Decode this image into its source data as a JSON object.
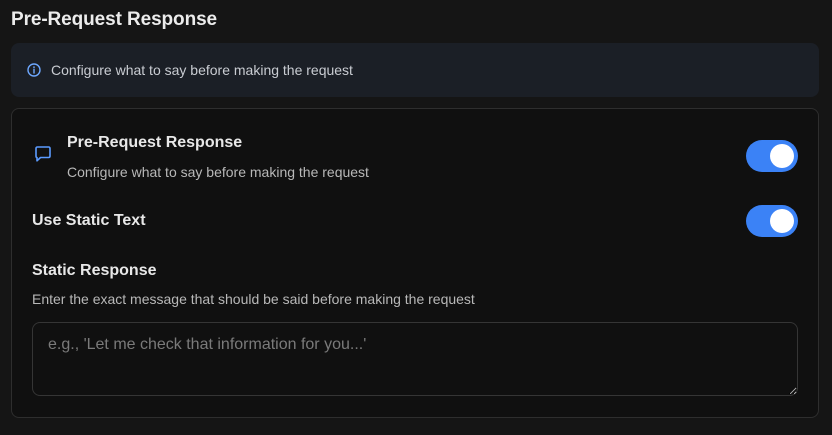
{
  "page": {
    "title": "Pre-Request Response"
  },
  "info_banner": {
    "icon": "info-icon",
    "text": "Configure what to say before making the request"
  },
  "pre_request": {
    "icon": "chat-bubble-icon",
    "title": "Pre-Request Response",
    "description": "Configure what to say before making the request",
    "enabled": true
  },
  "static_text": {
    "title": "Use Static Text",
    "enabled": true
  },
  "static_response": {
    "title": "Static Response",
    "description": "Enter the exact message that should be said before making the request",
    "value": "",
    "placeholder": "e.g., 'Let me check that information for you...'"
  },
  "colors": {
    "accent": "#3b82f6",
    "background": "#151515",
    "card": "#101010"
  }
}
